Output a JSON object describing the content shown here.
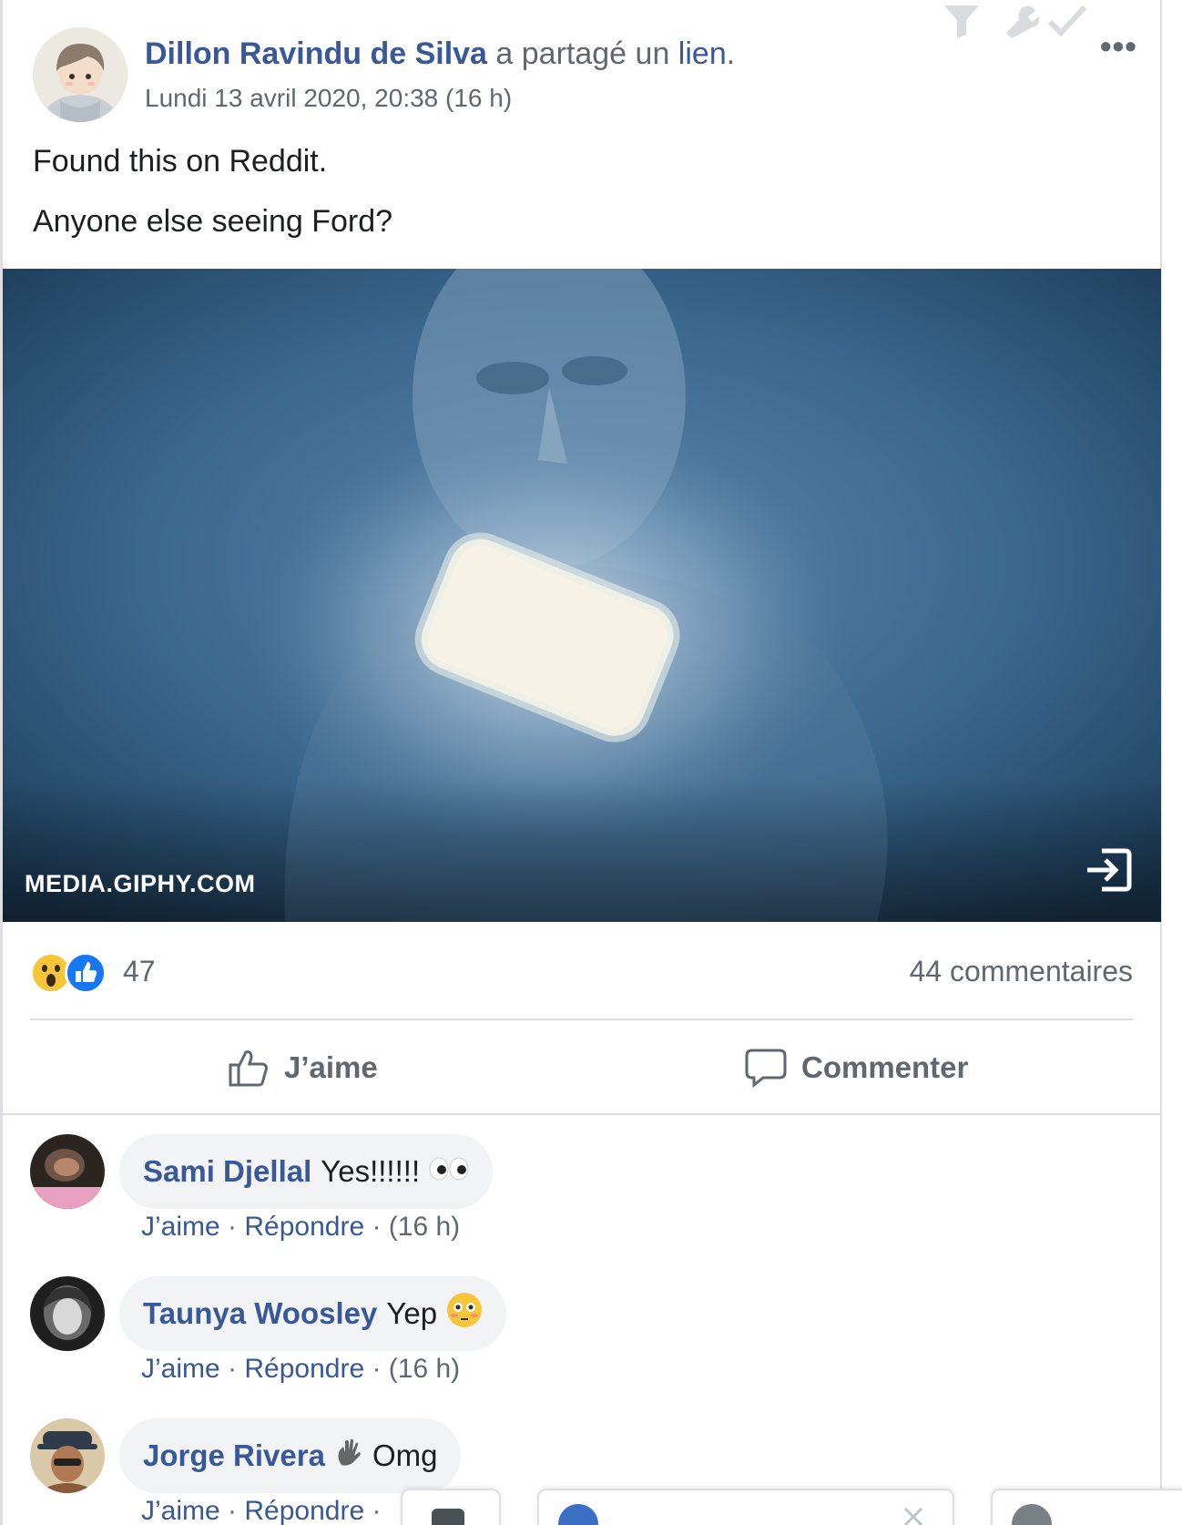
{
  "post": {
    "author": "Dillon Ravindu de Silva",
    "shared_text": " a partagé un ",
    "link_word": "lien",
    "period": ".",
    "timestamp": "Lundi 13 avril 2020, 20:38 (16 h)",
    "more_label": "•••",
    "lines": [
      "Found this on Reddit.",
      "Anyone else seeing Ford?"
    ],
    "media_source": "MEDIA.GIPHY.COM"
  },
  "stats": {
    "reaction_count": "47",
    "comments": "44 commentaires",
    "reaction_icons": [
      "wow-emoji-icon",
      "like-reaction-icon"
    ]
  },
  "actions": {
    "like": "J’aime",
    "comment": "Commenter"
  },
  "comments": [
    {
      "name": "Sami Djellal",
      "text": "Yes!!!!!!",
      "emoji": "eyes-emoji-icon",
      "like": "J’aime",
      "sep": " · ",
      "reply": "Répondre",
      "time": " · (16 h)"
    },
    {
      "name": "Taunya Woosley",
      "text": "Yep",
      "emoji": "flushed-emoji-icon",
      "like": "J’aime",
      "sep": " · ",
      "reply": "Répondre",
      "time": " · (16 h)"
    },
    {
      "name": "Jorge Rivera",
      "text": "Omg",
      "emoji": "waving-hand-icon",
      "like": "J’aime",
      "sep": " · ",
      "reply": "Répondre",
      "time": " ·"
    }
  ],
  "colors": {
    "link_blue": "#385898",
    "meta_gray": "#606770",
    "bubble_bg": "#f2f3f5",
    "like_blue": "#1877f2"
  }
}
